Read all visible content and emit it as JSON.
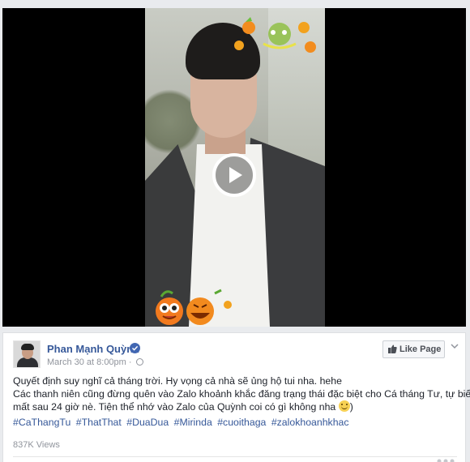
{
  "video": {
    "play_icon": "play-icon"
  },
  "post": {
    "author": "Phan Mạnh Quỳnh",
    "verified_icon": "verified-badge-icon",
    "date": "March 30 at 8:00pm",
    "separator": "·",
    "privacy_icon": "globe-icon",
    "like_page_label": "Like Page",
    "text_line1": "Quyết định suy nghĩ cả tháng trời. Hy vọng cả nhà sẽ ủng hộ tui nha. hehe",
    "text_line2": "Các thanh niên cũng đừng quên vào Zalo khoảnh khắc đăng trạng thái đặc biệt cho Cá tháng Tư, tự biến",
    "text_line3": "mất sau 24 giờ nè. Tiện thể nhớ vào Zalo của Quỳnh coi có gì không nha",
    "text_line3_end": ")",
    "hashtags": [
      "#CaThangTu",
      "#ThatThat",
      "#DuaDua",
      "#Mirinda",
      "#cuoithaga",
      "#zalokhoanhkhac"
    ],
    "views": "837K Views"
  },
  "colors": {
    "link": "#365899",
    "verified": "#4267b2",
    "muted": "#90949c"
  }
}
